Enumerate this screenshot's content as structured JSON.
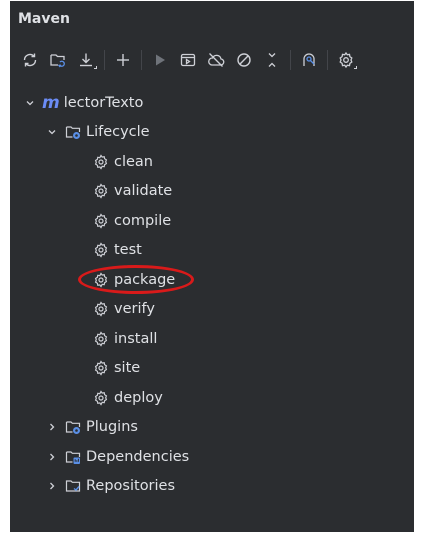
{
  "panel": {
    "title": "Maven"
  },
  "toolbar": {
    "buttons": [
      {
        "icon": "reload-icon"
      },
      {
        "icon": "generate-sources-icon"
      },
      {
        "icon": "download-icon"
      },
      {
        "icon": "add-icon"
      },
      {
        "icon": "run-icon"
      },
      {
        "icon": "execute-goal-icon"
      },
      {
        "icon": "offline-icon"
      },
      {
        "icon": "skip-tests-icon"
      },
      {
        "icon": "collapse-all-icon"
      },
      {
        "icon": "analyze-dependencies-icon"
      },
      {
        "icon": "settings-icon"
      }
    ]
  },
  "tree": {
    "project": "lectorTexto",
    "project_icon_letter": "m",
    "lifecycle": {
      "label": "Lifecycle",
      "goals": [
        "clean",
        "validate",
        "compile",
        "test",
        "package",
        "verify",
        "install",
        "site",
        "deploy"
      ]
    },
    "plugins": "Plugins",
    "dependencies": "Dependencies",
    "repositories": "Repositories"
  },
  "colors": {
    "panel_bg": "#2b2d30",
    "text": "#dfe1e5",
    "icon": "#ced0d6",
    "maven_blue": "#6b8cf5",
    "highlight": "#d91a1a"
  }
}
